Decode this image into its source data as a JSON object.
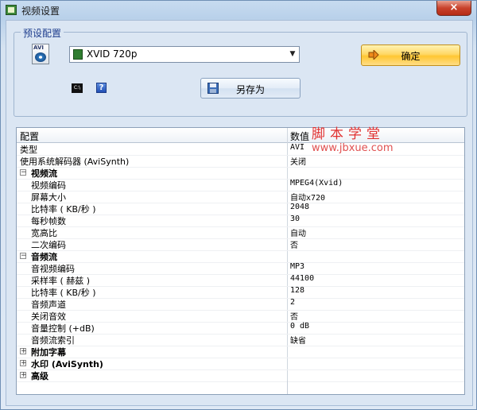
{
  "window": {
    "title": "视频设置",
    "close_glyph": "×"
  },
  "preset": {
    "group_label": "预设配置",
    "format_icon_text": "AVI",
    "selected": "XVID 720p",
    "ok_label": "确定",
    "saveas_label": "另存为",
    "cmd_icon_text": "C:\\",
    "help_icon_text": "?"
  },
  "grid": {
    "headers": {
      "key": "配置",
      "value": "数值"
    },
    "rows": [
      {
        "key": "类型",
        "value": "AVI",
        "level": 0
      },
      {
        "key": "使用系统解码器 (AviSynth)",
        "value": "关闭",
        "level": 0
      },
      {
        "key": "视频流",
        "value": "",
        "level": "cat",
        "expander": "−"
      },
      {
        "key": "视频编码",
        "value": "MPEG4(Xvid)",
        "level": 1
      },
      {
        "key": "屏幕大小",
        "value": "自动x720",
        "level": 1
      },
      {
        "key": "比特率 ( KB/秒 )",
        "value": "2048",
        "level": 1
      },
      {
        "key": "每秒帧数",
        "value": "30",
        "level": 1
      },
      {
        "key": "宽高比",
        "value": "自动",
        "level": 1
      },
      {
        "key": "二次编码",
        "value": "否",
        "level": 1
      },
      {
        "key": "音频流",
        "value": "",
        "level": "cat",
        "expander": "−"
      },
      {
        "key": "音视频编码",
        "value": "MP3",
        "level": 1
      },
      {
        "key": "采样率 ( 赫兹 )",
        "value": "44100",
        "level": 1
      },
      {
        "key": "比特率 ( KB/秒 )",
        "value": "128",
        "level": 1
      },
      {
        "key": "音频声道",
        "value": "2",
        "level": 1
      },
      {
        "key": "关闭音效",
        "value": "否",
        "level": 1
      },
      {
        "key": "音量控制 (+dB)",
        "value": "0 dB",
        "level": 1
      },
      {
        "key": "音频流索引",
        "value": "缺省",
        "level": 1
      },
      {
        "key": "附加字幕",
        "value": "",
        "level": "cat",
        "expander": "+"
      },
      {
        "key": "水印 (AviSynth)",
        "value": "",
        "level": "cat",
        "expander": "+"
      },
      {
        "key": "高级",
        "value": "",
        "level": "cat",
        "expander": "+"
      }
    ]
  },
  "watermark": {
    "title": "脚本学堂",
    "url": "www.jbxue.com"
  },
  "colors": {
    "accent": "#1f3e8e",
    "ok_button": "#ffd765",
    "watermark": "#e03030"
  }
}
